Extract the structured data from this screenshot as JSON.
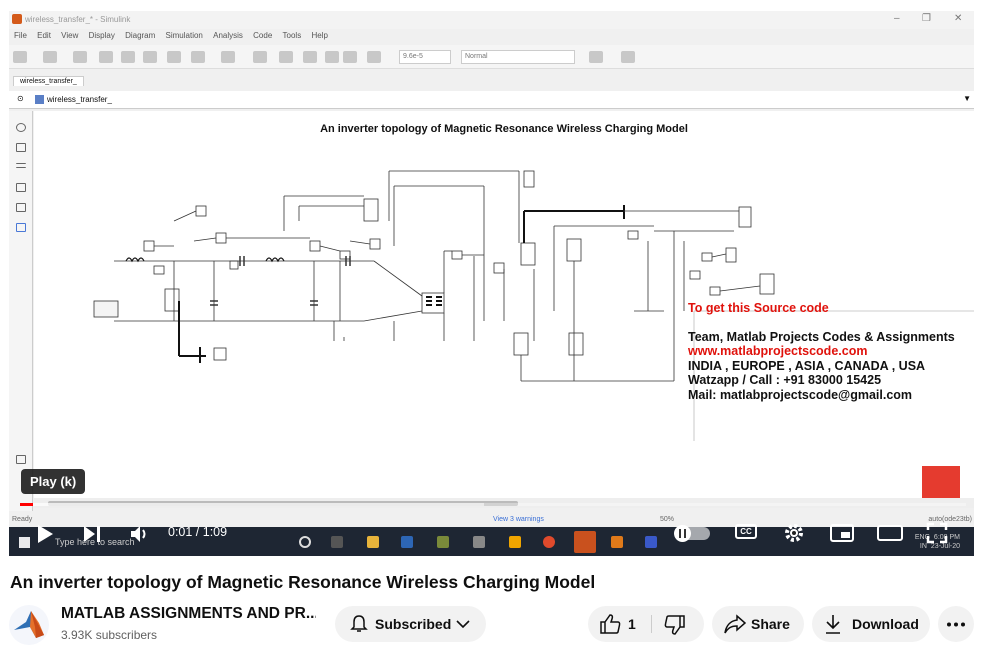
{
  "simulink": {
    "window_title": "wireless_transfer_* - Simulink",
    "menu": [
      "File",
      "Edit",
      "View",
      "Display",
      "Diagram",
      "Simulation",
      "Analysis",
      "Code",
      "Tools",
      "Help"
    ],
    "stop_time": "9.6e-5",
    "sim_mode": "Normal",
    "tab": "wireless_transfer_",
    "address": "wireless_transfer_",
    "model_title": "An inverter topology of Magnetic Resonance Wireless Charging Model",
    "info": {
      "heading": "To get this Source code",
      "team": "Team, Matlab Projects Codes & Assignments",
      "website": "www.matlabprojectscode.com",
      "regions": "INDIA , EUROPE , ASIA , CANADA , USA",
      "phone": "Watzapp / Call : +91 83000 15425",
      "mail": "Mail: matlabprojectscode@gmail.com"
    },
    "status": {
      "ready": "Ready",
      "warnings": "View 3 warnings",
      "zoom": "50%",
      "solver": "auto(ode23tb)"
    },
    "taskbar": {
      "search_placeholder": "Type here to search",
      "lang": "ENG",
      "region": "IN",
      "time": "6:08 PM",
      "date": "23-Jul-20"
    }
  },
  "player": {
    "tooltip": "Play (k)",
    "current_time": "0:01",
    "duration": "1:09",
    "time_display": "0:01 / 1:09",
    "progress": 0.014,
    "buffered": 0.49,
    "accent_color": "#ff0000"
  },
  "video": {
    "title": "An inverter topology of Magnetic Resonance Wireless Charging Model",
    "channel_name": "MATLAB ASSIGNMENTS AND PR...",
    "subscribers": "3.93K subscribers",
    "subscribe_label": "Subscribed",
    "likes": "1",
    "share_label": "Share",
    "download_label": "Download"
  },
  "icons": [
    "play-icon",
    "next-icon",
    "volume-icon",
    "autoplay-toggle",
    "cc-icon",
    "settings-icon",
    "miniplayer-icon",
    "theater-icon",
    "fullscreen-icon",
    "bell-icon",
    "chevron-down-icon",
    "thumbs-up-icon",
    "thumbs-down-icon",
    "share-icon",
    "download-icon",
    "more-icon"
  ]
}
